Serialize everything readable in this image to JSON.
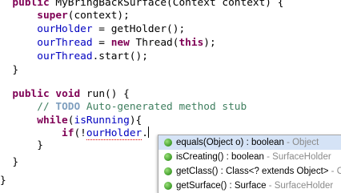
{
  "editor": {
    "lines": [
      {
        "id": "l1",
        "parts": [
          [
            "",
            "  "
          ],
          [
            "kw",
            "public"
          ],
          [
            "",
            " MyBringBackSurface(Context context) {"
          ]
        ]
      },
      {
        "id": "l2",
        "parts": [
          [
            "",
            "      "
          ],
          [
            "kw",
            "super"
          ],
          [
            "",
            "(context);"
          ]
        ]
      },
      {
        "id": "l3",
        "parts": [
          [
            "",
            "      "
          ],
          [
            "field",
            "ourHolder"
          ],
          [
            "",
            " = getHolder();"
          ]
        ]
      },
      {
        "id": "l4",
        "parts": [
          [
            "",
            "      "
          ],
          [
            "field",
            "ourThread"
          ],
          [
            "",
            " = "
          ],
          [
            "kw",
            "new"
          ],
          [
            "",
            " Thread("
          ],
          [
            "kw",
            "this"
          ],
          [
            "",
            ");"
          ]
        ]
      },
      {
        "id": "l5",
        "parts": [
          [
            "",
            "      "
          ],
          [
            "field",
            "ourThread"
          ],
          [
            "",
            ".start();"
          ]
        ]
      },
      {
        "id": "l6",
        "parts": [
          [
            "",
            "  }"
          ]
        ]
      },
      {
        "id": "l7",
        "parts": [
          [
            "",
            ""
          ]
        ]
      },
      {
        "id": "l8",
        "parts": [
          [
            "",
            "  "
          ],
          [
            "kw",
            "public"
          ],
          [
            "",
            " "
          ],
          [
            "kw",
            "void"
          ],
          [
            "",
            " run() {"
          ]
        ]
      },
      {
        "id": "l9",
        "parts": [
          [
            "",
            "      "
          ],
          [
            "comment",
            "// "
          ],
          [
            "todo",
            "TODO"
          ],
          [
            "comment",
            " Auto-generated method stub"
          ]
        ]
      },
      {
        "id": "l10",
        "parts": [
          [
            "",
            "      "
          ],
          [
            "kw",
            "while"
          ],
          [
            "",
            "("
          ],
          [
            "field",
            "isRunning"
          ],
          [
            "",
            "){"
          ]
        ]
      },
      {
        "id": "l11",
        "parts": [
          [
            "",
            "          "
          ],
          [
            "kw",
            "if"
          ],
          [
            "",
            "(!"
          ],
          [
            "field errword",
            "ourHolder"
          ],
          [
            "",
            "."
          ],
          [
            "caret",
            ""
          ]
        ]
      },
      {
        "id": "l12",
        "parts": [
          [
            "",
            "      }"
          ]
        ]
      },
      {
        "id": "l13",
        "parts": [
          [
            "",
            "  }"
          ]
        ]
      },
      {
        "id": "l14",
        "parts": [
          [
            "",
            ""
          ]
        ]
      },
      {
        "id": "l15",
        "parts": [
          [
            "",
            "}"
          ]
        ]
      }
    ]
  },
  "autocomplete": {
    "items": [
      {
        "sig": "equals(Object o) : boolean",
        "owner": " - Object",
        "selected": true
      },
      {
        "sig": "isCreating() : boolean",
        "owner": " - SurfaceHolder",
        "selected": false
      },
      {
        "sig": "getClass() : Class<? extends Object>",
        "owner": " - Object",
        "selected": false
      },
      {
        "sig": "getSurface() : Surface",
        "owner": " - SurfaceHolder",
        "selected": false
      }
    ]
  }
}
